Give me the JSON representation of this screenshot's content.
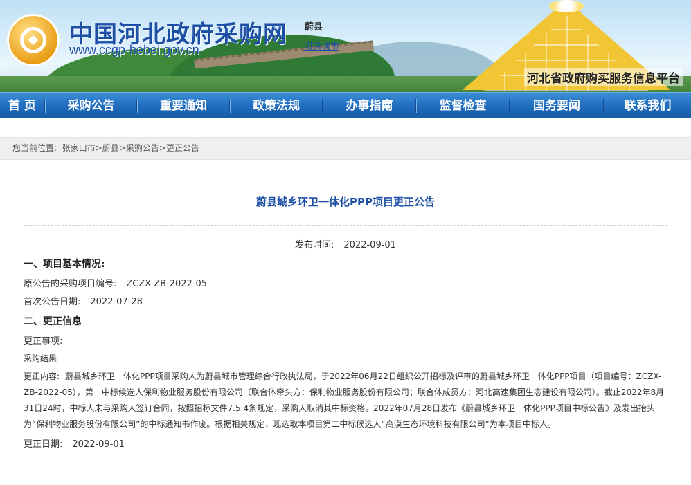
{
  "header": {
    "site_title": "中国河北政府采购网",
    "site_url": "www.ccgp-hebei.gov.cn",
    "city": "蔚县",
    "switch_city": "切换城市",
    "platform": "河北省政府购买服务信息平台"
  },
  "nav": {
    "items": [
      "首 页",
      "采购公告",
      "重要通知",
      "政策法规",
      "办事指南",
      "监督检查",
      "国务要闻",
      "联系我们"
    ]
  },
  "breadcrumb": {
    "prefix": "您当前位置:",
    "items": [
      "张家口市",
      "蔚县",
      "采购公告",
      "更正公告"
    ],
    "separator": ">"
  },
  "article": {
    "title": "蔚县城乡环卫一体化PPP项目更正公告",
    "publish_label": "发布时间:",
    "publish_date": "2022-09-01",
    "section1": "一、项目基本情况:",
    "orig_no_label": "原公告的采购项目编号:",
    "orig_no": "ZCZX-ZB-2022-05",
    "first_date_label": "首次公告日期:",
    "first_date": "2022-07-28",
    "section2": "二、更正信息",
    "item_label": "更正事项:",
    "item_value": "采购结果",
    "content_label": "更正内容:",
    "content_text": "蔚县城乡环卫一体化PPP项目采购人为蔚县城市管理综合行政执法局，于2022年06月22日组织公开招标及评审的蔚县城乡环卫一体化PPP项目（项目编号：ZCZX-ZB-2022-05），第一中标候选人保利物业服务股份有限公司（联合体牵头方：保利物业服务股份有限公司；联合体成员方：河北高速集团生态建设有限公司）。截止2022年8月31日24时，中标人未与采购人签订合同，按照招标文件7.5.4条规定，采购人取消其中标资格。2022年07月28日发布《蔚县城乡环卫一体化PPP项目中标公告》及发出抬头为“保利物业服务股份有限公司”的中标通知书作废。根据相关规定，现选取本项目第二中标候选人“高漠生态环境科技有限公司”为本项目中标人。",
    "change_date_label": "更正日期:",
    "change_date": "2022-09-01"
  }
}
